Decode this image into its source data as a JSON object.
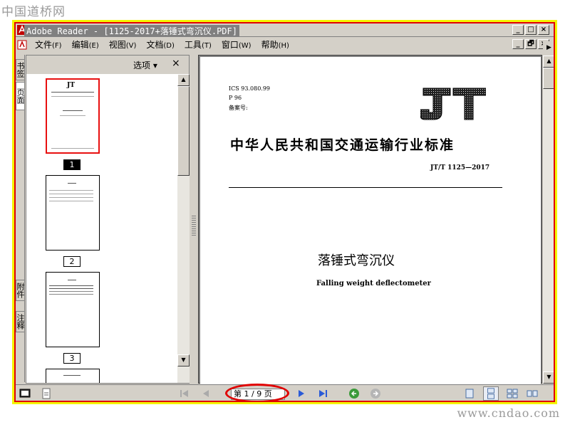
{
  "site": {
    "logo_text": "中国道桥网",
    "url_text": "www.cndao.com"
  },
  "window": {
    "title": "Adobe Reader - [1125-2017+落锤式弯沉仪.PDF]",
    "buttons": [
      "_",
      "□",
      "×"
    ],
    "doc_buttons": [
      "_",
      "🗗",
      "×"
    ]
  },
  "menu": {
    "items": [
      {
        "label": "文件",
        "accel": "(F)"
      },
      {
        "label": "编辑",
        "accel": "(E)"
      },
      {
        "label": "视图",
        "accel": "(V)"
      },
      {
        "label": "文档",
        "accel": "(D)"
      },
      {
        "label": "工具",
        "accel": "(T)"
      },
      {
        "label": "窗口",
        "accel": "(W)"
      },
      {
        "label": "帮助",
        "accel": "(H)"
      }
    ]
  },
  "side_tabs": [
    "书签",
    "页面",
    "附件",
    "注释"
  ],
  "panel": {
    "options_label": "选项 ▾",
    "close_label": "×",
    "thumbnails": [
      {
        "label": "1",
        "selected": true
      },
      {
        "label": "2",
        "selected": false
      },
      {
        "label": "3",
        "selected": false
      }
    ]
  },
  "document": {
    "ics": "ICS 93.080.99",
    "p": "P 96",
    "record": "备案号:",
    "logo": "JT",
    "standard_title": "中华人民共和国交通运输行业标准",
    "standard_code": "JT/T 1125—2017",
    "title_cn": "落锤式弯沉仪",
    "title_en": "Falling weight deflectometer"
  },
  "statusbar": {
    "page_indicator": "第 1 / 9 页"
  },
  "colors": {
    "frame_yellow": "#f4f400",
    "frame_red": "#e00000",
    "window_gray": "#d4d0c8",
    "nav_green": "#3a9a3a"
  }
}
